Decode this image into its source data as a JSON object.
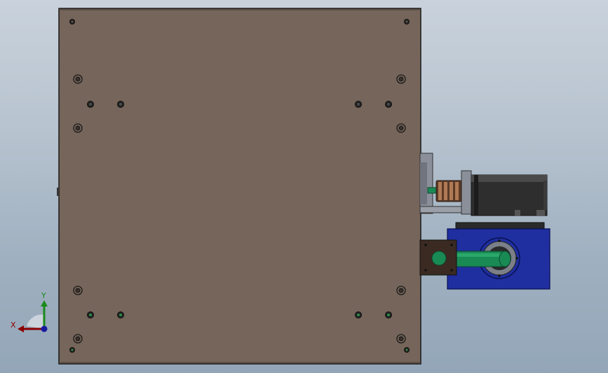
{
  "viewport": {
    "gradient_top": "#c9d2dc",
    "gradient_bottom": "#93a6b8"
  },
  "colors": {
    "plate_fill": "#75655a",
    "plate_edge": "#1a1a1a",
    "gearbox_blue": "#1f2fa0",
    "motor_body": "#2e2e2e",
    "shaft_green": "#1a8a55",
    "bracket_grey": "#8a8f9a",
    "coupling_copper": "#b07a55",
    "mount_brown": "#3a2a22"
  },
  "plate": {
    "hole_icon": "countersunk-hole-icon",
    "screw_icon": "screw-head-icon"
  },
  "components": {
    "motor": "servo-motor-icon",
    "coupling": "bellows-coupling-icon",
    "bracket": "motor-bracket-icon",
    "gearbox": "right-angle-gearbox-icon",
    "shaft": "output-shaft-icon",
    "mount": "bearing-mount-icon"
  },
  "triad": {
    "x_label": "X",
    "y_label": "Y",
    "x_color": "#8b0000",
    "y_color": "#1a8a1a",
    "z_color": "#1a1a9e"
  }
}
